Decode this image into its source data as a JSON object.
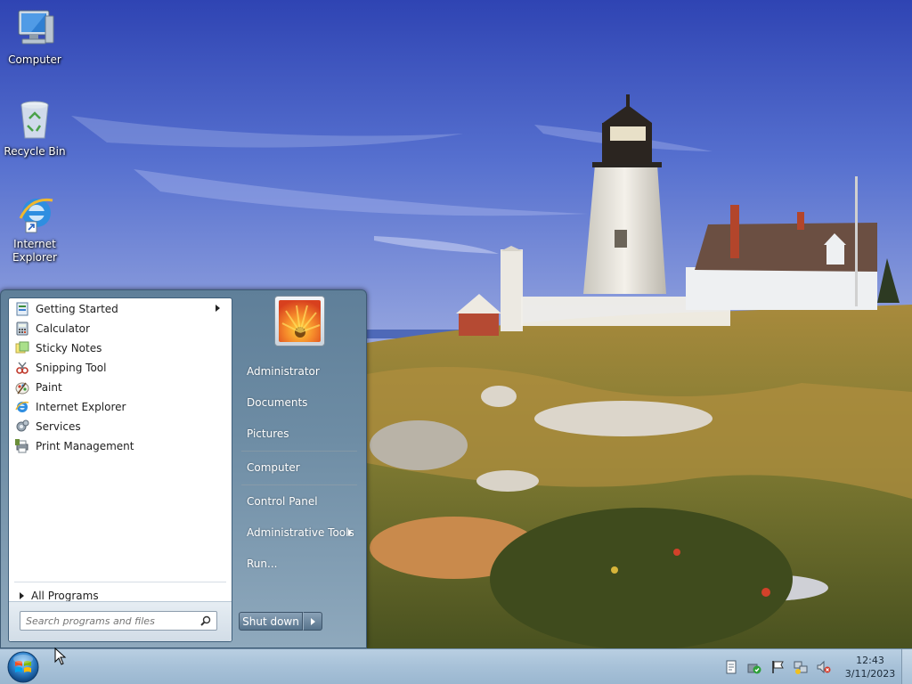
{
  "desktop": {
    "icons": [
      {
        "label": "Computer"
      },
      {
        "label": "Recycle Bin"
      },
      {
        "label": "Internet\nExplorer"
      }
    ]
  },
  "start_menu": {
    "programs": [
      {
        "label": "Getting Started",
        "has_submenu": true,
        "icon": "getting-started-icon"
      },
      {
        "label": "Calculator",
        "icon": "calculator-icon"
      },
      {
        "label": "Sticky Notes",
        "icon": "sticky-notes-icon"
      },
      {
        "label": "Snipping Tool",
        "icon": "snipping-tool-icon"
      },
      {
        "label": "Paint",
        "icon": "paint-icon"
      },
      {
        "label": "Internet Explorer",
        "icon": "internet-explorer-icon"
      },
      {
        "label": "Services",
        "icon": "services-icon"
      },
      {
        "label": "Print Management",
        "icon": "print-management-icon"
      }
    ],
    "all_programs": "All Programs",
    "search_placeholder": "Search programs and files",
    "right_items": [
      {
        "label": "Administrator"
      },
      {
        "label": "Documents"
      },
      {
        "label": "Pictures"
      },
      {
        "label": "Computer"
      },
      {
        "label": "Control Panel"
      },
      {
        "label": "Administrative Tools",
        "has_submenu": true
      },
      {
        "label": "Run..."
      }
    ],
    "shutdown_label": "Shut down"
  },
  "taskbar": {
    "clock_time": "12:43",
    "clock_date": "3/11/2023",
    "tray_icons": [
      "action-center-icon",
      "security-icon",
      "flag-icon",
      "network-icon",
      "volume-muted-icon"
    ]
  },
  "colors": {
    "taskbar": "#a7c1d8",
    "start_menu_right": "#6d8ca4",
    "sky": "#3f5fbf"
  }
}
